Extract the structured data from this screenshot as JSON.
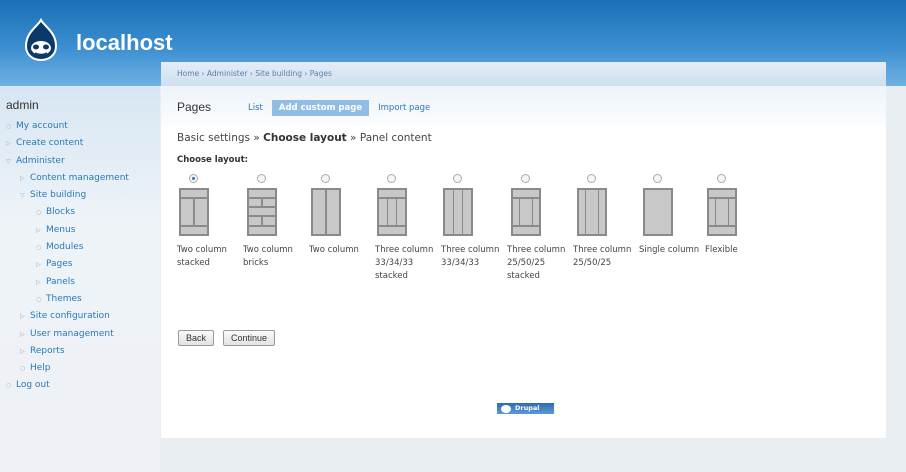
{
  "site": {
    "name": "localhost"
  },
  "sidebar": {
    "user": "admin",
    "items": [
      {
        "label": "My account",
        "indent": 0,
        "bullet": "○"
      },
      {
        "label": "Create content",
        "indent": 0,
        "bullet": "▷"
      },
      {
        "label": "Administer",
        "indent": 0,
        "bullet": "▽"
      },
      {
        "label": "Content management",
        "indent": 1,
        "bullet": "▷"
      },
      {
        "label": "Site building",
        "indent": 1,
        "bullet": "▽"
      },
      {
        "label": "Blocks",
        "indent": 2,
        "bullet": "○"
      },
      {
        "label": "Menus",
        "indent": 2,
        "bullet": "▷"
      },
      {
        "label": "Modules",
        "indent": 2,
        "bullet": "○"
      },
      {
        "label": "Pages",
        "indent": 2,
        "bullet": "▷"
      },
      {
        "label": "Panels",
        "indent": 2,
        "bullet": "▷"
      },
      {
        "label": "Themes",
        "indent": 2,
        "bullet": "○"
      },
      {
        "label": "Site configuration",
        "indent": 1,
        "bullet": "▷"
      },
      {
        "label": "User management",
        "indent": 1,
        "bullet": "▷"
      },
      {
        "label": "Reports",
        "indent": 1,
        "bullet": "▷"
      },
      {
        "label": "Help",
        "indent": 1,
        "bullet": "○"
      },
      {
        "label": "Log out",
        "indent": 0,
        "bullet": "○"
      }
    ]
  },
  "breadcrumb": "Home › Administer › Site building › Pages",
  "page": {
    "title": "Pages",
    "tabs": [
      {
        "label": "List",
        "active": false
      },
      {
        "label": "Add custom page",
        "active": true
      },
      {
        "label": "Import page",
        "active": false
      }
    ]
  },
  "steps": {
    "first": "Basic settings",
    "sep": "»",
    "current": "Choose layout",
    "last": "Panel content"
  },
  "choose_label": "Choose layout:",
  "layouts": [
    {
      "label": "Two column stacked",
      "icon": "two-column-stacked",
      "selected": true
    },
    {
      "label": "Two column bricks",
      "icon": "two-column-bricks",
      "selected": false
    },
    {
      "label": "Two column",
      "icon": "two-column",
      "selected": false
    },
    {
      "label": "Three column 33/34/33 stacked",
      "icon": "three-column-33-34-33-stacked",
      "selected": false
    },
    {
      "label": "Three column 33/34/33",
      "icon": "three-column-33-34-33",
      "selected": false
    },
    {
      "label": "Three column 25/50/25 stacked",
      "icon": "three-column-25-50-25-stacked",
      "selected": false
    },
    {
      "label": "Three column 25/50/25",
      "icon": "three-column-25-50-25",
      "selected": false
    },
    {
      "label": "Single column",
      "icon": "single-column",
      "selected": false
    },
    {
      "label": "Flexible",
      "icon": "flexible",
      "selected": false
    }
  ],
  "buttons": {
    "back": "Back",
    "continue": "Continue"
  },
  "footer_badge": "Drupal"
}
